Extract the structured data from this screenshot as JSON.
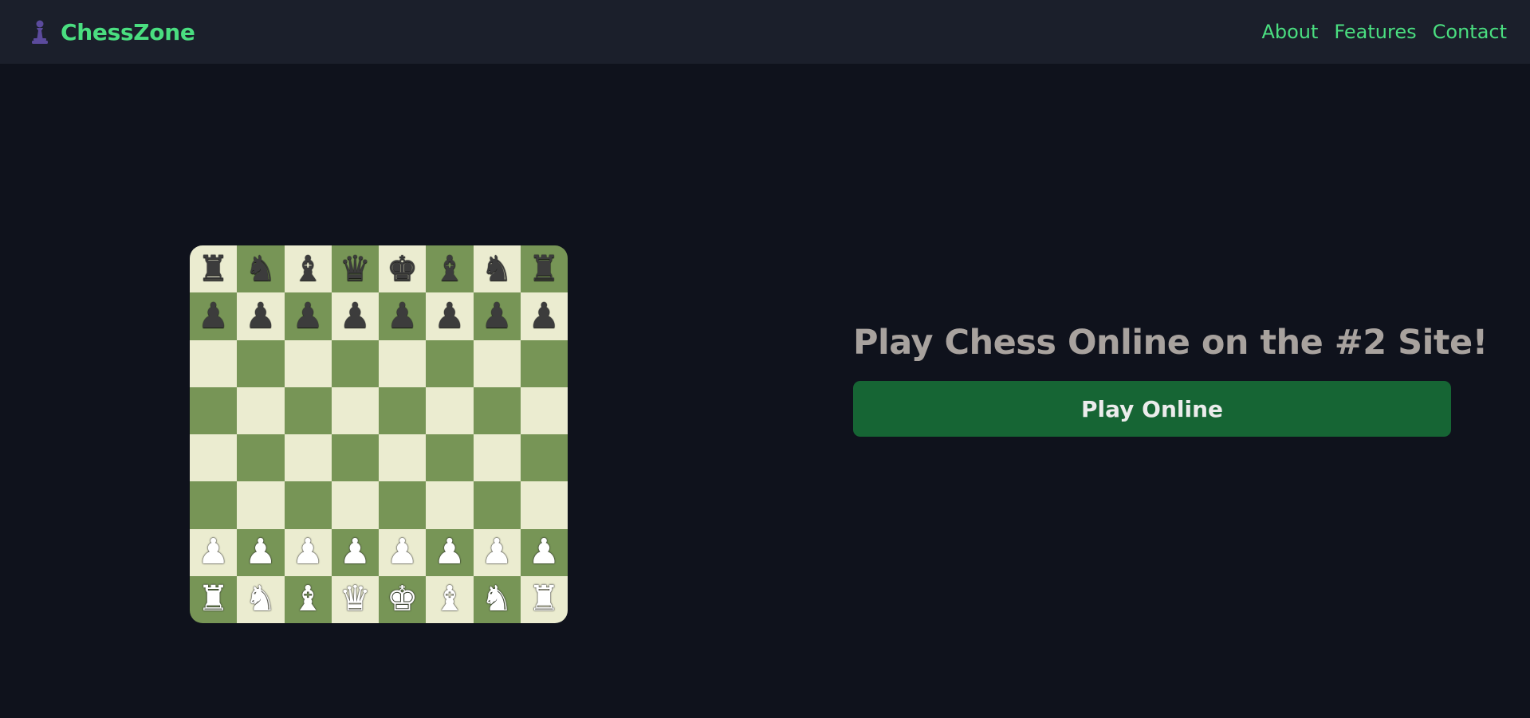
{
  "header": {
    "brand_icon": "chess-pawn-icon",
    "brand_name": "ChessZone",
    "nav": [
      "About",
      "Features",
      "Contact"
    ]
  },
  "hero": {
    "title": "Play Chess Online on the #2 Site!",
    "button_label": "Play Online"
  },
  "board": {
    "light_color": "#ebecd0",
    "dark_color": "#779556",
    "rows": [
      [
        "bR",
        "bN",
        "bB",
        "bQ",
        "bK",
        "bB",
        "bN",
        "bR"
      ],
      [
        "bP",
        "bP",
        "bP",
        "bP",
        "bP",
        "bP",
        "bP",
        "bP"
      ],
      [
        "",
        "",
        "",
        "",
        "",
        "",
        "",
        ""
      ],
      [
        "",
        "",
        "",
        "",
        "",
        "",
        "",
        ""
      ],
      [
        "",
        "",
        "",
        "",
        "",
        "",
        "",
        ""
      ],
      [
        "",
        "",
        "",
        "",
        "",
        "",
        "",
        ""
      ],
      [
        "wP",
        "wP",
        "wP",
        "wP",
        "wP",
        "wP",
        "wP",
        "wP"
      ],
      [
        "wR",
        "wN",
        "wB",
        "wQ",
        "wK",
        "wB",
        "wN",
        "wR"
      ]
    ]
  },
  "colors": {
    "accent": "#4ade80",
    "background": "#0f121c",
    "header_bg": "#1b1f2b",
    "button_bg": "#166534",
    "title_color": "#a8a29e"
  }
}
